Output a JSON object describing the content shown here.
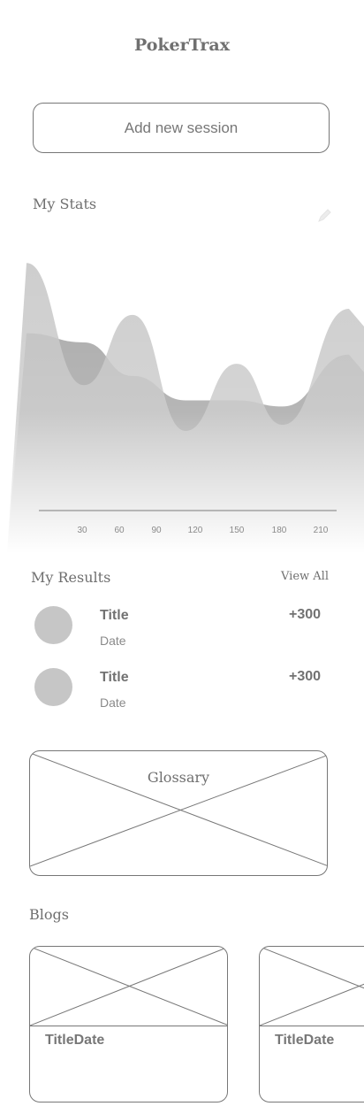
{
  "app": {
    "title": "PokerTrax"
  },
  "actions": {
    "add_session_label": "Add new session"
  },
  "stats": {
    "heading": "My Stats",
    "edit_icon": "pencil-icon",
    "chart_data": {
      "type": "area",
      "x": [
        30,
        60,
        90,
        120,
        150,
        180,
        210
      ],
      "x_tick_labels": [
        "30",
        "60",
        "90",
        "120",
        "150",
        "180",
        "210"
      ],
      "series": [
        {
          "values": [
            72,
            69,
            58,
            50,
            50,
            48,
            65
          ]
        },
        {
          "values": [
            95,
            55,
            78,
            40,
            62,
            42,
            80
          ]
        }
      ],
      "ylim": [
        0,
        100
      ],
      "grid": false,
      "colors": [
        "#a9a9a9",
        "#c4c4c4"
      ]
    }
  },
  "results": {
    "heading": "My Results",
    "view_all_label": "View All",
    "items": [
      {
        "title": "Title",
        "date": "Date",
        "amount": "+300"
      },
      {
        "title": "Title",
        "date": "Date",
        "amount": "+300"
      }
    ]
  },
  "glossary": {
    "label": "Glossary"
  },
  "blogs": {
    "heading": "Blogs",
    "items": [
      {
        "title": "Title",
        "date": "Date"
      },
      {
        "title": "Title",
        "date": "Date"
      }
    ]
  }
}
